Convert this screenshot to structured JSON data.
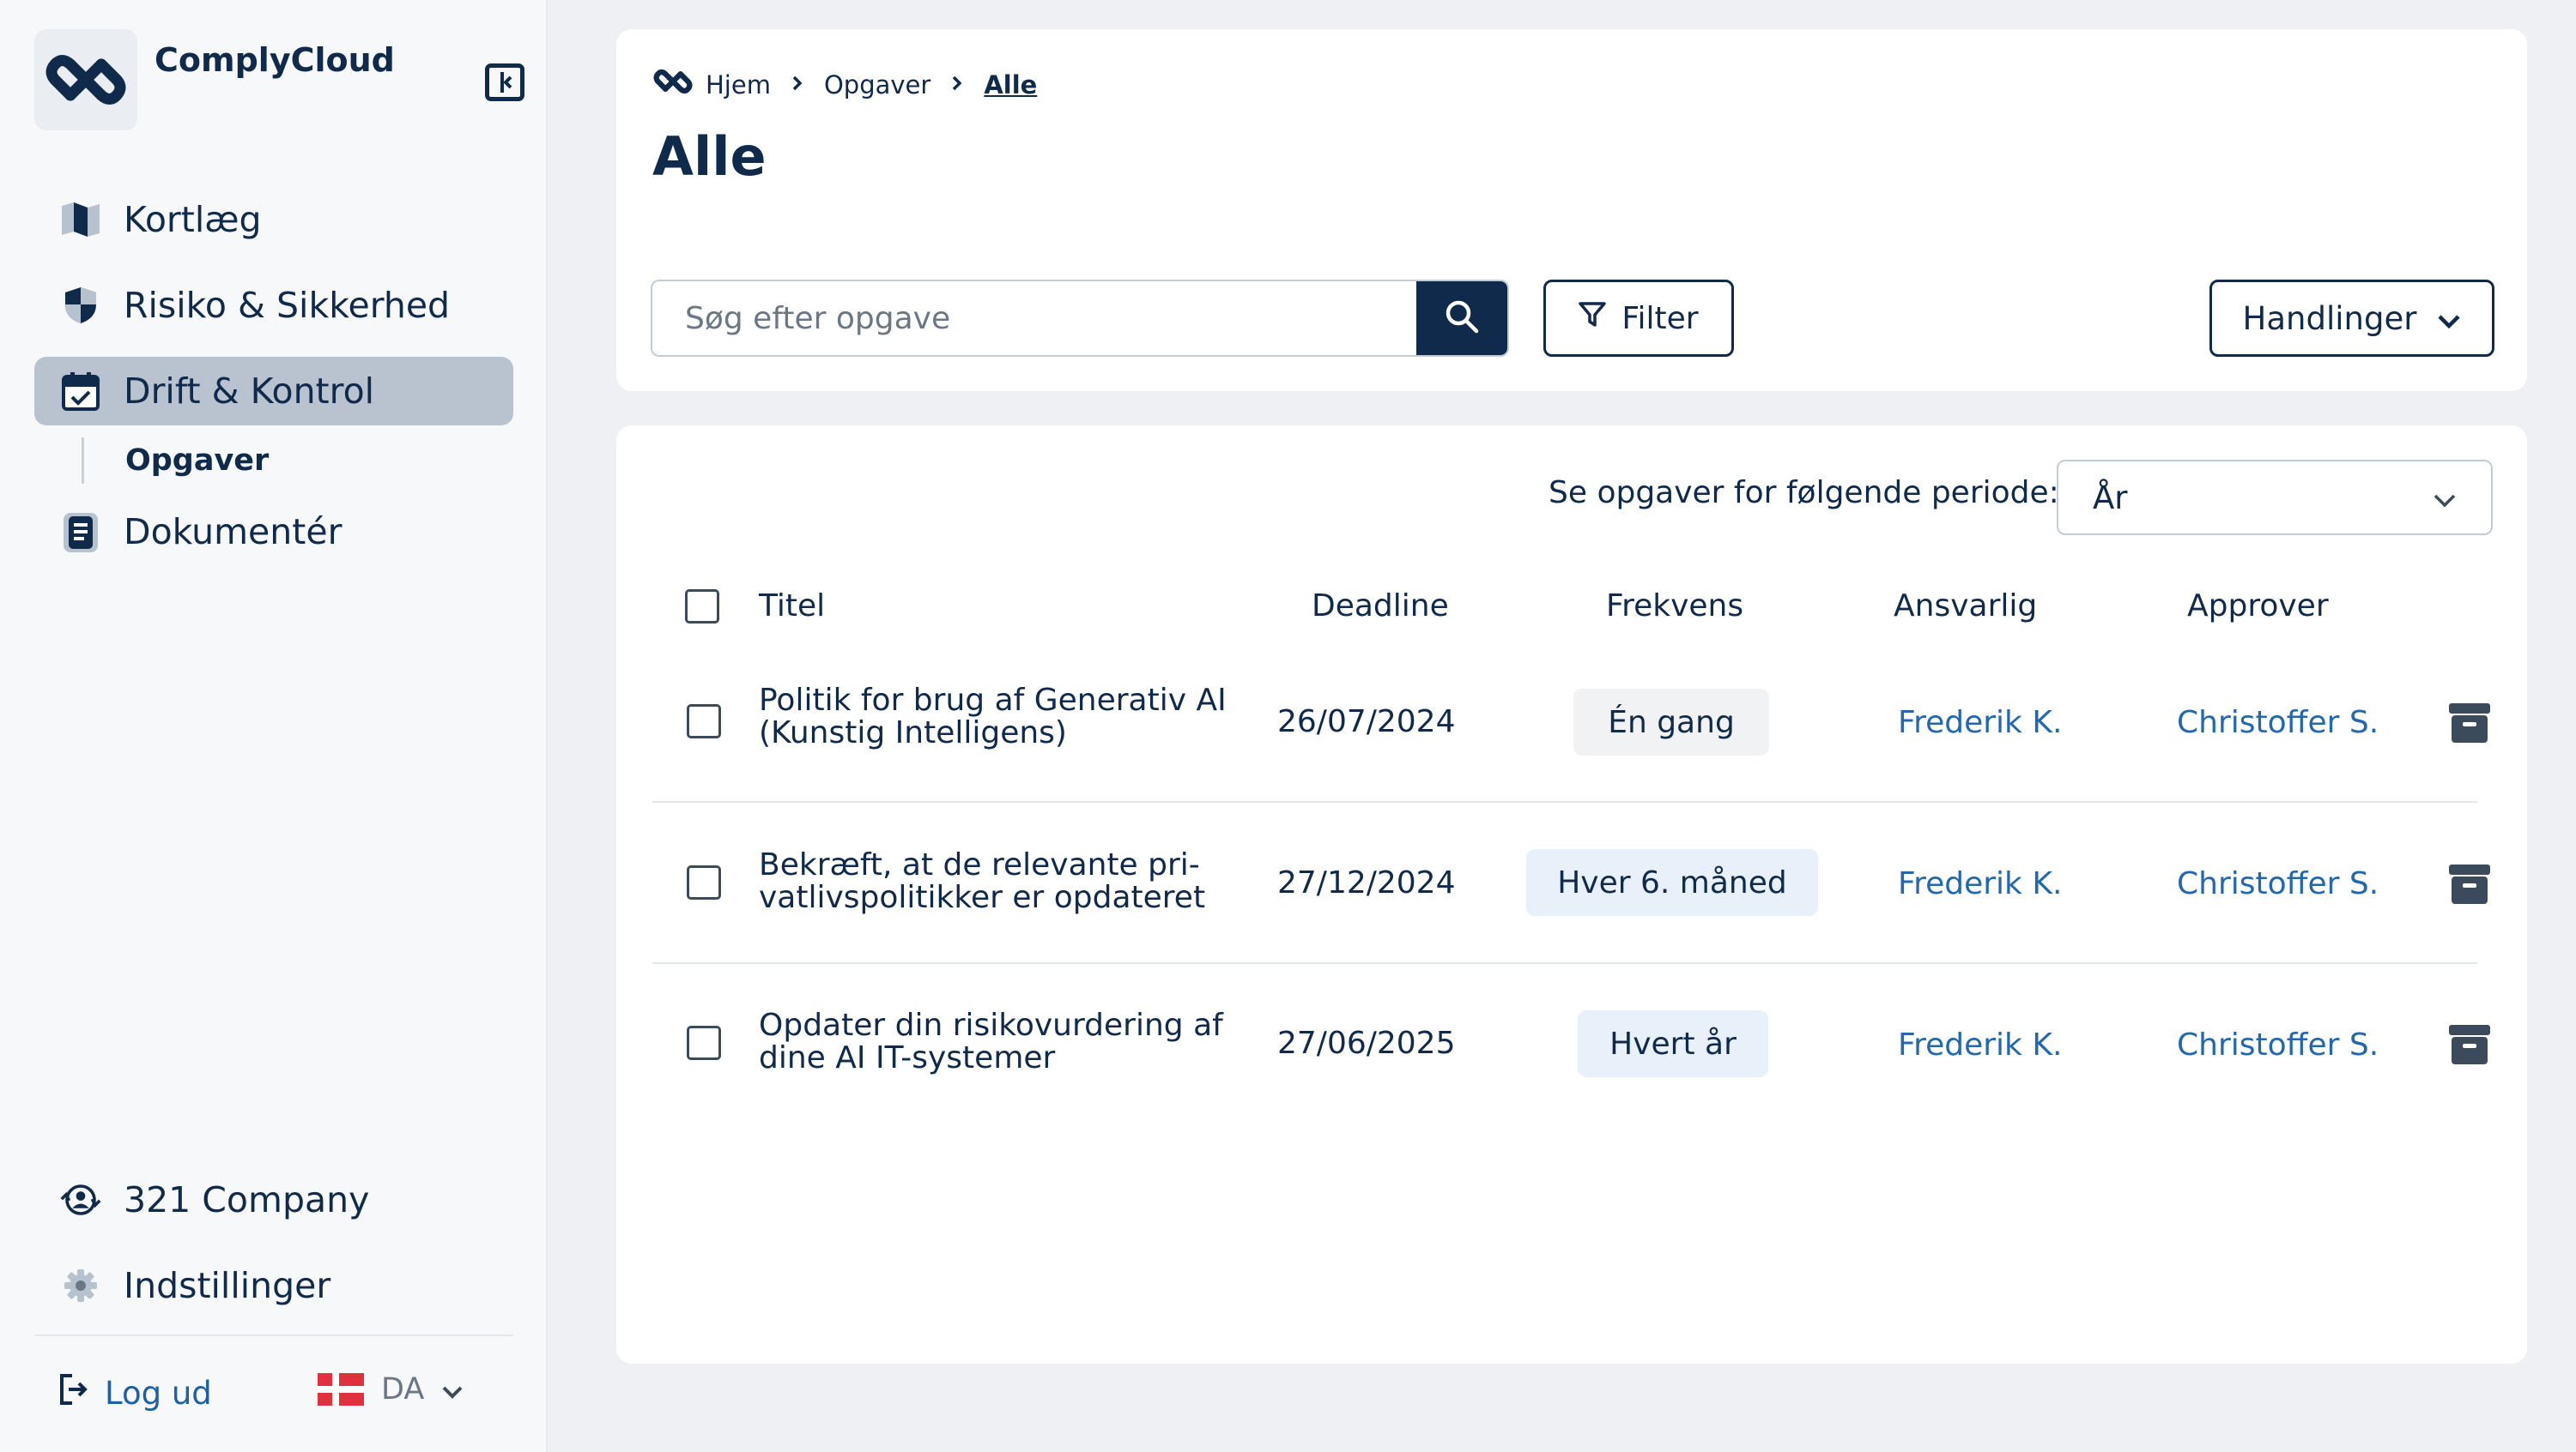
{
  "app": {
    "name": "ComplyCloud"
  },
  "sidebar": {
    "items": [
      {
        "label": "Kortlæg",
        "icon": "map-icon"
      },
      {
        "label": "Risiko & Sikkerhed",
        "icon": "shield-icon"
      },
      {
        "label": "Drift & Kontrol",
        "icon": "calendar-check-icon",
        "active": true
      },
      {
        "label": "Dokumentér",
        "icon": "document-icon"
      }
    ],
    "sub_item": "Opgaver",
    "company": "321 Company",
    "settings": "Indstillinger",
    "logout": "Log ud",
    "language": "DA"
  },
  "breadcrumb": {
    "home": "Hjem",
    "section": "Opgaver",
    "current": "Alle"
  },
  "page": {
    "title": "Alle"
  },
  "toolbar": {
    "search_placeholder": "Søg efter opgave",
    "filter_label": "Filter",
    "actions_label": "Handlinger"
  },
  "period": {
    "label": "Se opgaver for følgende periode:",
    "selected": "År"
  },
  "table": {
    "columns": [
      "Titel",
      "Deadline",
      "Frekvens",
      "Ansvarlig",
      "Approver"
    ],
    "rows": [
      {
        "title_line1": "Politik for brug af Generativ AI",
        "title_line2": "(Kunstig Intelligens)",
        "deadline": "26/07/2024",
        "frequency": "Én gang",
        "responsible": "Frederik K.",
        "approver": "Christoffer S."
      },
      {
        "title_line1": "Bekræft, at de relevante pri-",
        "title_line2": "vatlivspolitikker er opdateret",
        "deadline": "27/12/2024",
        "frequency": "Hver 6. måned",
        "responsible": "Frederik K.",
        "approver": "Christoffer S."
      },
      {
        "title_line1": "Opdater din risikovurdering af",
        "title_line2": "dine AI IT-systemer",
        "deadline": "27/06/2025",
        "frequency": "Hvert år",
        "responsible": "Frederik K.",
        "approver": "Christoffer S."
      }
    ]
  },
  "colors": {
    "primary": "#0f2a4a",
    "link": "#2367ae",
    "active_nav": "#b9c3cf",
    "badge_grey": "#f1f2f4",
    "badge_blue": "#e8f0fa",
    "background": "#eef0f4"
  }
}
